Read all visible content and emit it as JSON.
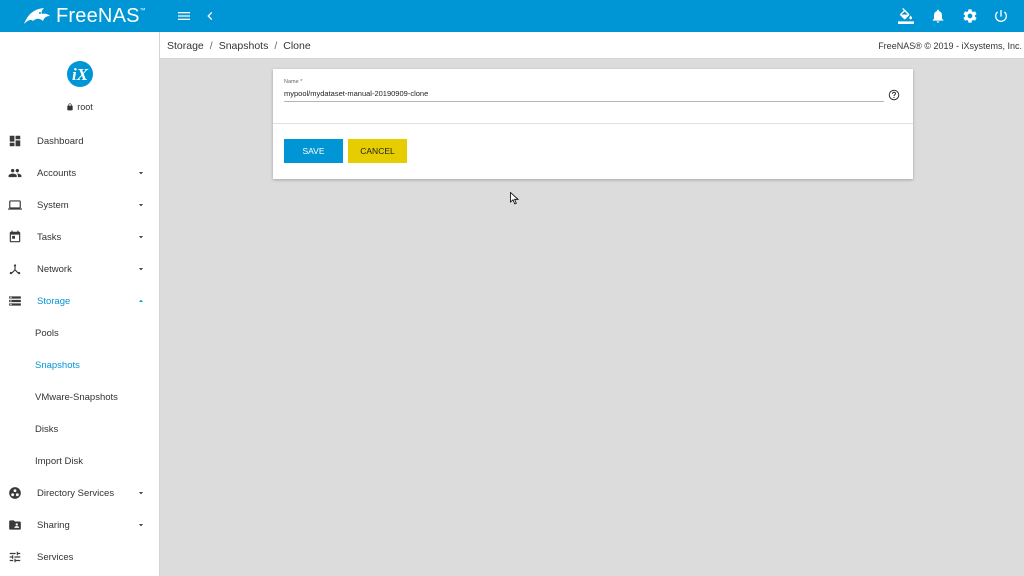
{
  "app": {
    "brand": "FreeNAS",
    "brand_tm": "™"
  },
  "topbar": {
    "icons": [
      "menu-icon",
      "chevron-left-icon",
      "theme-paint-icon",
      "notifications-bell-icon",
      "settings-gear-icon",
      "power-icon"
    ]
  },
  "sidebar": {
    "user": "root",
    "items": [
      {
        "label": "Dashboard",
        "icon": "dashboard-icon"
      },
      {
        "label": "Accounts",
        "icon": "accounts-icon"
      },
      {
        "label": "System",
        "icon": "laptop-icon"
      },
      {
        "label": "Tasks",
        "icon": "calendar-icon"
      },
      {
        "label": "Network",
        "icon": "network-icon"
      },
      {
        "label": "Storage",
        "icon": "storage-icon"
      },
      {
        "label": "Directory Services",
        "icon": "directory-icon"
      },
      {
        "label": "Sharing",
        "icon": "folder-share-icon"
      },
      {
        "label": "Services",
        "icon": "tune-icon"
      }
    ],
    "storage_sub": [
      "Pools",
      "Snapshots",
      "VMware-Snapshots",
      "Disks",
      "Import Disk"
    ]
  },
  "breadcrumb": {
    "items": [
      "Storage",
      "Snapshots",
      "Clone"
    ],
    "separator": "/"
  },
  "copyright": "FreeNAS® © 2019 - iXsystems, Inc.",
  "form": {
    "name_label": "Name *",
    "name_value": "mypool/mydataset-manual-20190909-clone",
    "save_label": "SAVE",
    "cancel_label": "CANCEL"
  },
  "colors": {
    "accent": "#0095d5",
    "cancel": "#e6cd00",
    "background": "#dcdcdc"
  }
}
